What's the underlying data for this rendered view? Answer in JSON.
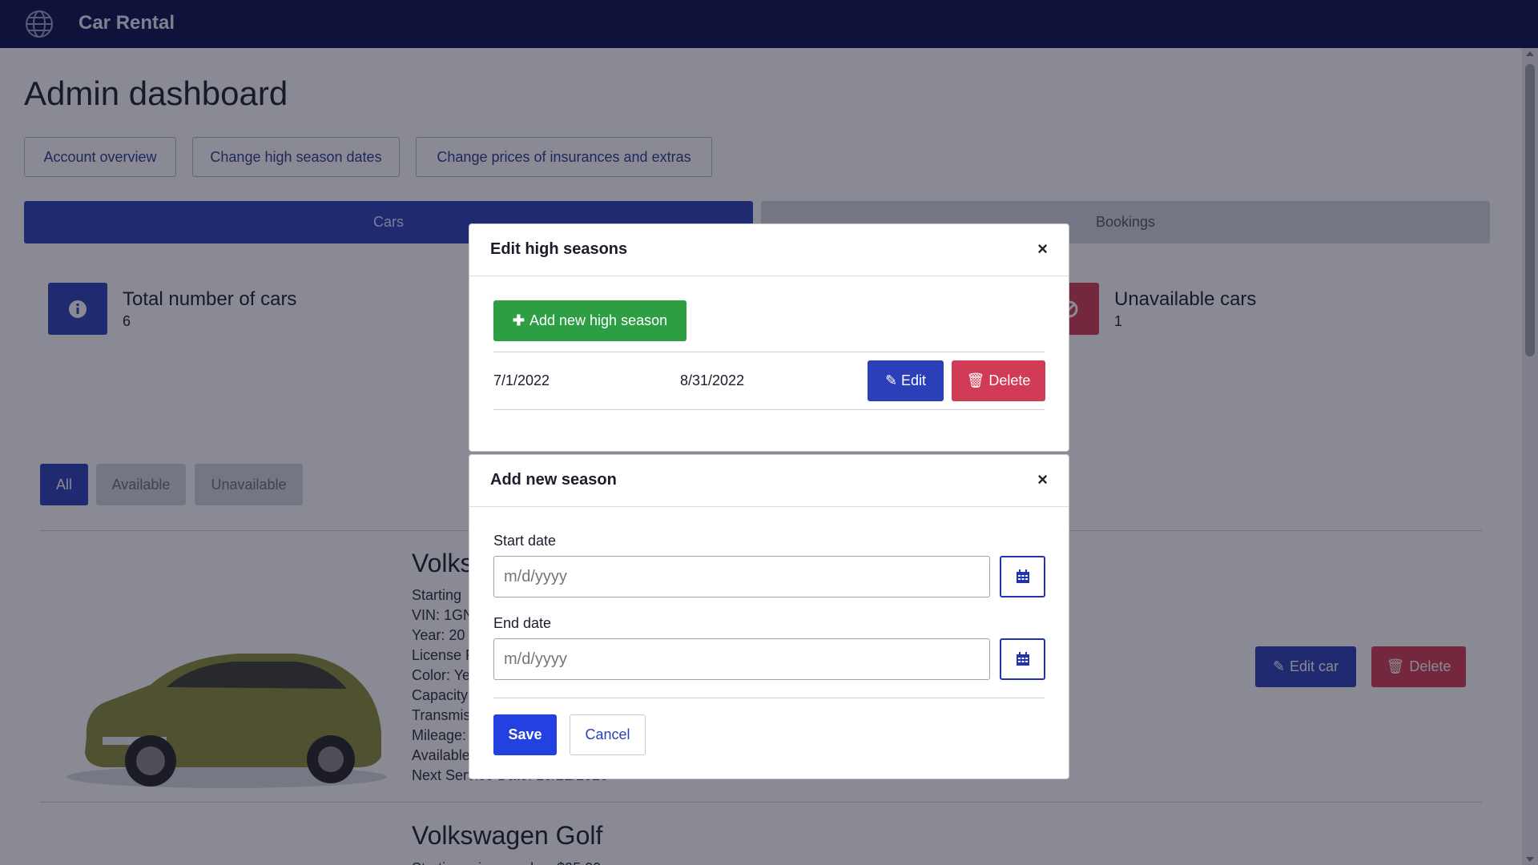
{
  "navbar": {
    "brand": "Car Rental",
    "icon": "globe-icon"
  },
  "page": {
    "title": "Admin dashboard"
  },
  "toplinks": [
    "Account overview",
    "Change high season dates",
    "Change prices of insurances and extras"
  ],
  "tabs": {
    "cars": "Cars",
    "bookings": "Bookings"
  },
  "stats": {
    "total": {
      "label": "Total number of cars",
      "value": "6",
      "icon": "info-icon"
    },
    "unavailable": {
      "label": "Unavailable cars",
      "value": "1",
      "icon": "ban-icon"
    }
  },
  "filters": [
    "All",
    "Available",
    "Unavailable"
  ],
  "car1": {
    "title": "Volks",
    "info": [
      "Starting",
      "VIN: 1GN",
      "Year: 20",
      "License P",
      "Color: Ye",
      "Capacity",
      "Transmis",
      "Mileage:",
      "Available",
      "Next Service Date: 10/21/2023"
    ],
    "edit_label": "Edit car",
    "delete_label": "Delete"
  },
  "car2": {
    "title": "Volkswagen Golf",
    "info_partial": "Starting price per day: $95.00"
  },
  "high_seasons_modal": {
    "title": "Edit high seasons",
    "close": "×",
    "add_label": "Add new high season",
    "seasons": [
      {
        "start": "7/1/2022",
        "end": "8/31/2022",
        "edit_label": "Edit",
        "delete_label": "Delete"
      }
    ]
  },
  "add_season_modal": {
    "title": "Add new season",
    "close": "×",
    "start_label": "Start date",
    "start_placeholder": "m/d/yyyy",
    "end_label": "End date",
    "end_placeholder": "m/d/yyyy",
    "save_label": "Save",
    "cancel_label": "Cancel"
  },
  "colors": {
    "navbar": "#0a1150",
    "primary": "#2a3fb8",
    "success": "#2e9e44",
    "danger": "#d23b55",
    "save": "#2340e0"
  }
}
